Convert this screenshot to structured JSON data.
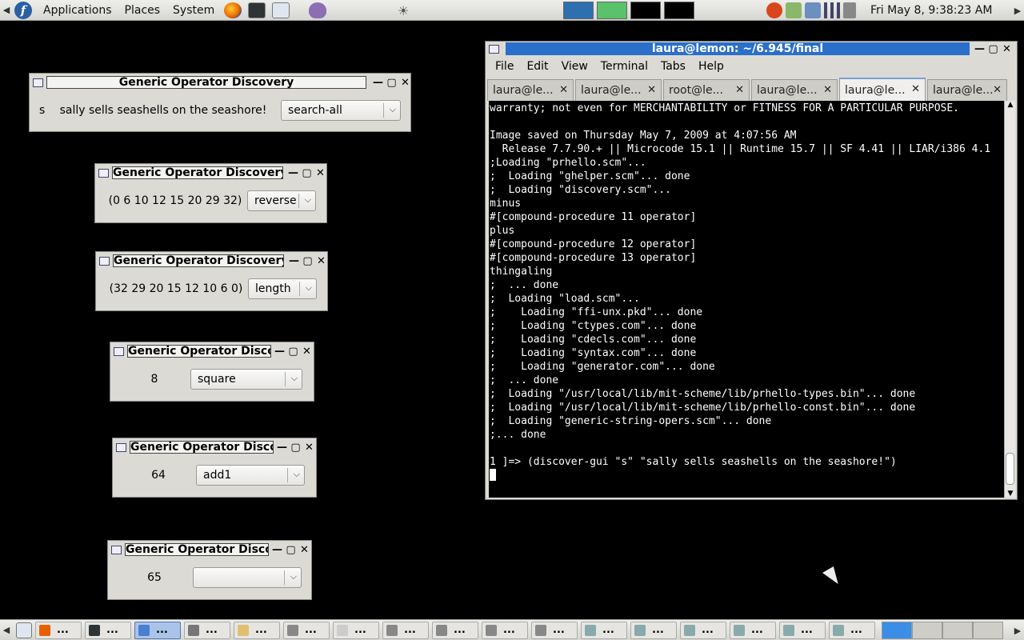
{
  "top_panel": {
    "menus": [
      "Applications",
      "Places",
      "System"
    ],
    "clock": "Fri May  8,  9:38:23 AM"
  },
  "dialogs": [
    {
      "title": "Generic Operator Discovery",
      "extra": "s",
      "arg": "sally sells seashells on the seashore!",
      "op": "search-all"
    },
    {
      "title": "Generic Operator Discovery",
      "arg": "(0 6 10 12 15 20 29 32)",
      "op": "reverse"
    },
    {
      "title": "Generic Operator Discovery",
      "arg": "(32 29 20 15 12 10 6 0)",
      "op": "length"
    },
    {
      "title": "Generic Operator Discovery",
      "arg": "8",
      "op": "square"
    },
    {
      "title": "Generic Operator Discovery",
      "arg": "64",
      "op": "add1"
    },
    {
      "title": "Generic Operator Discovery",
      "arg": "65",
      "op": ""
    }
  ],
  "terminal": {
    "title": "laura@lemon: ~/6.945/final",
    "menu": [
      "File",
      "Edit",
      "View",
      "Terminal",
      "Tabs",
      "Help"
    ],
    "tabs": [
      "laura@le...",
      "laura@le...",
      "root@le...",
      "laura@le...",
      "laura@le...",
      "laura@le..."
    ],
    "active_tab": 4,
    "lines": [
      "warranty; not even for MERCHANTABILITY or FITNESS FOR A PARTICULAR PURPOSE.",
      "",
      "Image saved on Thursday May 7, 2009 at 4:07:56 AM",
      "  Release 7.7.90.+ || Microcode 15.1 || Runtime 15.7 || SF 4.41 || LIAR/i386 4.1",
      ";Loading \"prhello.scm\"...",
      ";  Loading \"ghelper.scm\"... done",
      ";  Loading \"discovery.scm\"...",
      "minus",
      "#[compound-procedure 11 operator]",
      "plus",
      "#[compound-procedure 12 operator]",
      "#[compound-procedure 13 operator]",
      "thingaling",
      ";  ... done",
      ";  Loading \"load.scm\"...",
      ";    Loading \"ffi-unx.pkd\"... done",
      ";    Loading \"ctypes.com\"... done",
      ";    Loading \"cdecls.com\"... done",
      ";    Loading \"syntax.com\"... done",
      ";    Loading \"generator.com\"... done",
      ";  ... done",
      ";  Loading \"/usr/local/lib/mit-scheme/lib/prhello-types.bin\"... done",
      ";  Loading \"/usr/local/lib/mit-scheme/lib/prhello-const.bin\"... done",
      ";  Loading \"generic-string-opers.scm\"... done",
      ";... done",
      "",
      "1 ]=> (discover-gui \"s\" \"sally sells seashells on the seashore!\")"
    ]
  },
  "bottom_panel": {
    "tasks": [
      "...",
      "...",
      "...",
      "...",
      "...",
      "...",
      "...",
      "...",
      "...",
      "...",
      "...",
      "...",
      "...",
      "...",
      "...",
      "...",
      "..."
    ],
    "active_task": 2
  }
}
